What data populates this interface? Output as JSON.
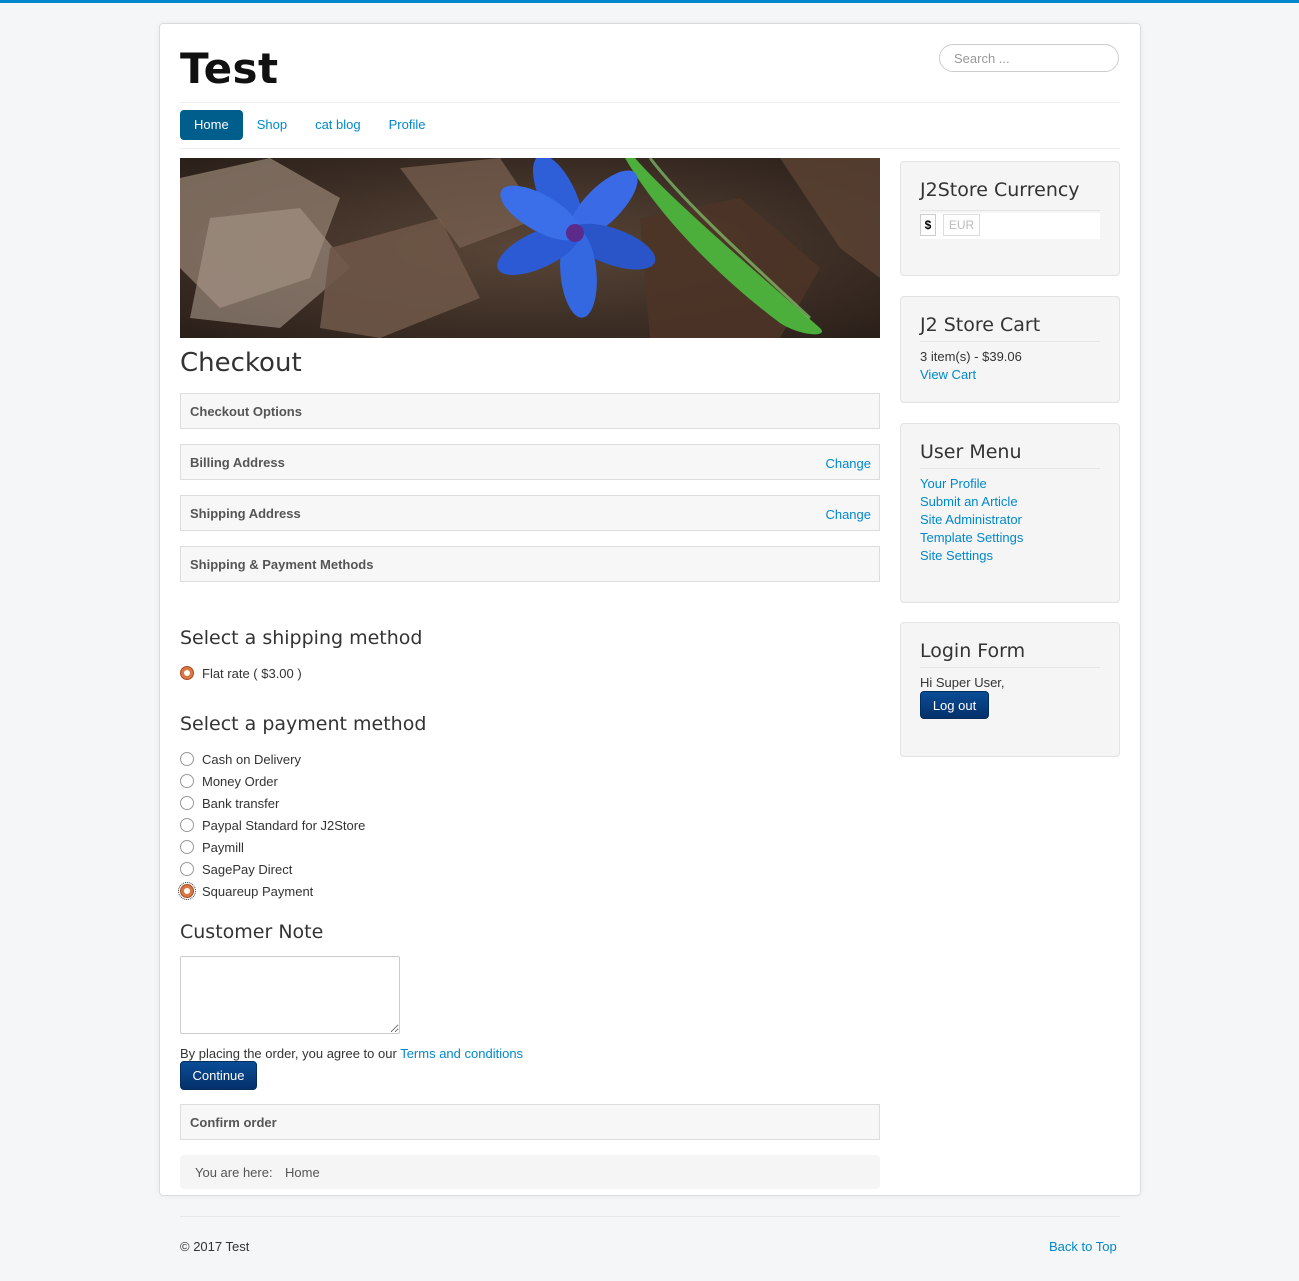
{
  "site": {
    "brand": "Test",
    "search_placeholder": "Search ..."
  },
  "nav": {
    "items": [
      "Home",
      "Shop",
      "cat blog",
      "Profile"
    ],
    "active": "Home"
  },
  "checkout": {
    "title": "Checkout",
    "panels": {
      "checkout_options": "Checkout Options",
      "billing_address": "Billing Address",
      "billing_change": "Change",
      "shipping_address": "Shipping Address",
      "shipping_change": "Change",
      "shipping_payment_methods": "Shipping & Payment Methods",
      "confirm_order": "Confirm order"
    },
    "shipping": {
      "heading": "Select a shipping method",
      "options": [
        "Flat rate ( $3.00 )"
      ],
      "selected": "Flat rate ( $3.00 )"
    },
    "payment": {
      "heading": "Select a payment method",
      "options": [
        "Cash on Delivery",
        "Money Order",
        "Bank transfer",
        "Paypal Standard for J2Store",
        "Paymill",
        "SagePay Direct",
        "Squareup Payment"
      ],
      "selected": "Squareup Payment"
    },
    "note": {
      "heading": "Customer Note",
      "value": ""
    },
    "terms_text": "By placing the order, you agree to our",
    "terms_link": "Terms and conditions",
    "continue_button": "Continue"
  },
  "breadcrumb": {
    "label": "You are here:",
    "item": "Home"
  },
  "sidebar": {
    "currency": {
      "title": "J2Store Currency",
      "symbol": "$",
      "code": "EUR"
    },
    "cart": {
      "title": "J2 Store Cart",
      "summary": "3 item(s) - $39.06",
      "view_cart": "View Cart"
    },
    "user_menu": {
      "title": "User Menu",
      "items": [
        "Your Profile",
        "Submit an Article",
        "Site Administrator",
        "Template Settings",
        "Site Settings"
      ]
    },
    "login": {
      "title": "Login Form",
      "greeting": "Hi Super User,",
      "logout_button": "Log out"
    }
  },
  "footer": {
    "copyright": "© 2017 Test",
    "back_to_top": "Back to Top"
  },
  "colors": {
    "accent": "#0088cc",
    "nav_active": "#005e8d",
    "button": "#04306a",
    "radio_on": "#d97745"
  }
}
